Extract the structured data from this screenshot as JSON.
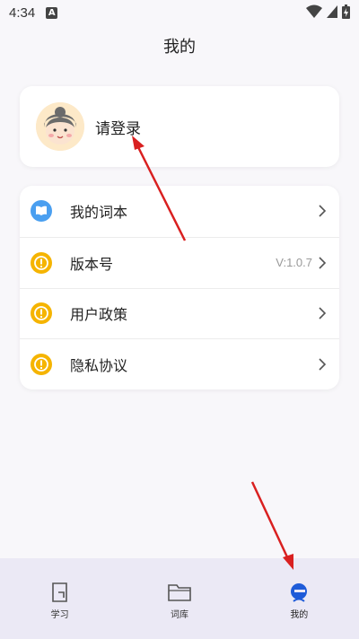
{
  "status_bar": {
    "time": "4:34",
    "notification_letter": "A"
  },
  "header": {
    "title": "我的"
  },
  "profile": {
    "login_text": "请登录"
  },
  "menu": [
    {
      "label": "我的词本",
      "value": "",
      "icon": "book-icon"
    },
    {
      "label": "版本号",
      "value": "V:1.0.7",
      "icon": "info-icon"
    },
    {
      "label": "用户政策",
      "value": "",
      "icon": "info-icon"
    },
    {
      "label": "隐私协议",
      "value": "",
      "icon": "info-icon"
    }
  ],
  "tabs": [
    {
      "label": "学习",
      "icon": "study-icon",
      "active": false
    },
    {
      "label": "词库",
      "icon": "folder-icon",
      "active": false
    },
    {
      "label": "我的",
      "icon": "profile-icon",
      "active": true
    }
  ],
  "colors": {
    "accent_blue": "#1e5bd8",
    "book_blue": "#4a9ff0",
    "info_amber": "#f5b400",
    "annotation_red": "#d92020"
  }
}
